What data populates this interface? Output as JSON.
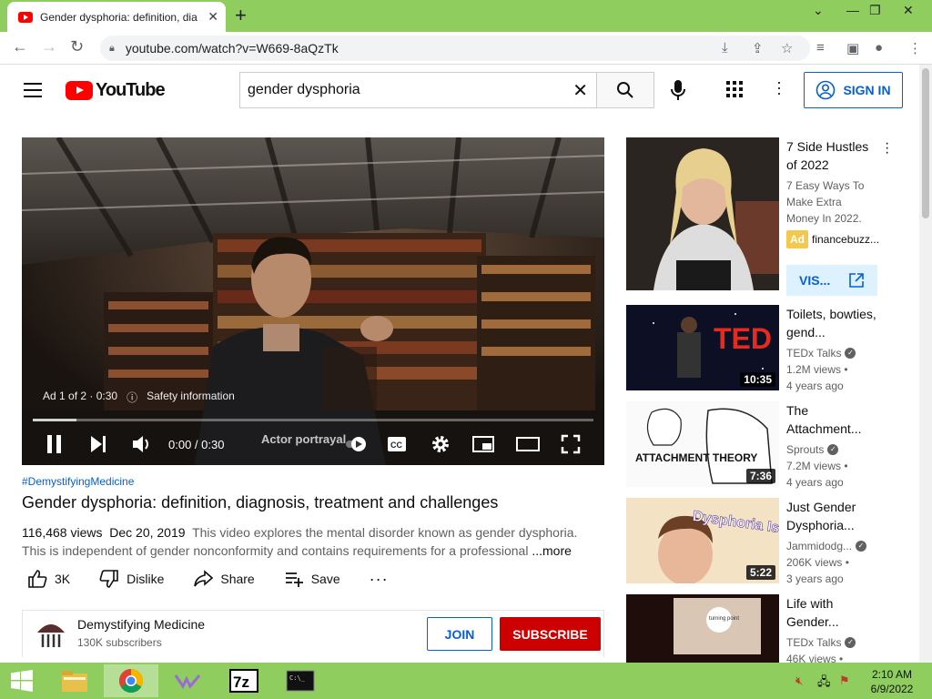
{
  "browser": {
    "tab_title": "Gender dysphoria: definition, dia",
    "url": "youtube.com/watch?v=W669-8aQzTk"
  },
  "header": {
    "logo_text": "YouTube",
    "search_value": "gender dysphoria",
    "signin_label": "SIGN IN"
  },
  "player": {
    "ad_label": "Ad 1 of 2 · 0:30",
    "safety_label": "Safety information",
    "time": "0:00 / 0:30",
    "overlay_text": "Actor portrayal"
  },
  "video": {
    "hashtag": "#DemystifyingMedicine",
    "title": "Gender dysphoria: definition, diagnosis, treatment and challenges",
    "views": "116,468 views",
    "date": "Dec 20, 2019",
    "description": "This video explores the mental disorder known as gender dysphoria. This is independent of gender nonconformity and contains requirements for a professional",
    "more_label": "...more",
    "likes": "3K",
    "dislike_label": "Dislike",
    "share_label": "Share",
    "save_label": "Save"
  },
  "channel": {
    "name": "Demystifying Medicine",
    "subscribers": "130K subscribers",
    "join_label": "JOIN",
    "subscribe_label": "SUBSCRIBE"
  },
  "sidebar": {
    "ad": {
      "title": "7 Side Hustles of 2022",
      "description": "7 Easy Ways To Make Extra Money In 2022.",
      "badge": "Ad",
      "advertiser": "financebuzz...",
      "visit_label": "VIS..."
    },
    "items": [
      {
        "title": "Toilets, bowties, gend...",
        "channel": "TEDx Talks",
        "views": "1.2M views •",
        "age": "4 years ago",
        "duration": "10:35",
        "thumb_text": "TED Adole"
      },
      {
        "title": "The Attachment...",
        "channel": "Sprouts",
        "views": "7.2M views •",
        "age": "4 years ago",
        "duration": "7:36",
        "thumb_text": "ATTACHMENT THEORY"
      },
      {
        "title": "Just Gender Dysphoria...",
        "channel": "Jammidodg...",
        "views": "206K views •",
        "age": "3 years ago",
        "duration": "5:22",
        "thumb_text": "Dysphoria Is Weird"
      },
      {
        "title": "Life with Gender...",
        "channel": "TEDx Talks",
        "views": "46K views •",
        "age": "",
        "duration": "",
        "thumb_text": "turning point"
      }
    ]
  },
  "taskbar": {
    "time": "2:10 AM",
    "date": "6/9/2022"
  }
}
